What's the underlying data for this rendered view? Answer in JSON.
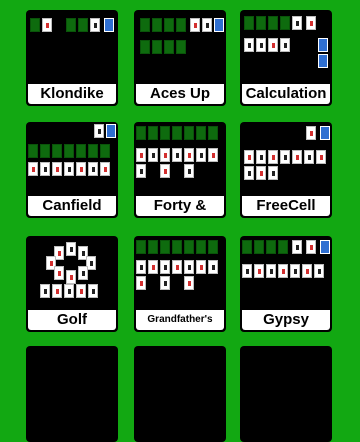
{
  "games": [
    {
      "label": "Klondike"
    },
    {
      "label": "Aces Up"
    },
    {
      "label": "Calculation"
    },
    {
      "label": "Canfield"
    },
    {
      "label": "Forty & Eight"
    },
    {
      "label": "FreeCell"
    },
    {
      "label": "Golf"
    },
    {
      "label": "Grandfather's Clock"
    },
    {
      "label": "Gypsy"
    }
  ],
  "colors": {
    "background": "#12a812",
    "tile": "#000000",
    "card_back": "#2f6fd1",
    "slot": "#0e6b0e"
  }
}
